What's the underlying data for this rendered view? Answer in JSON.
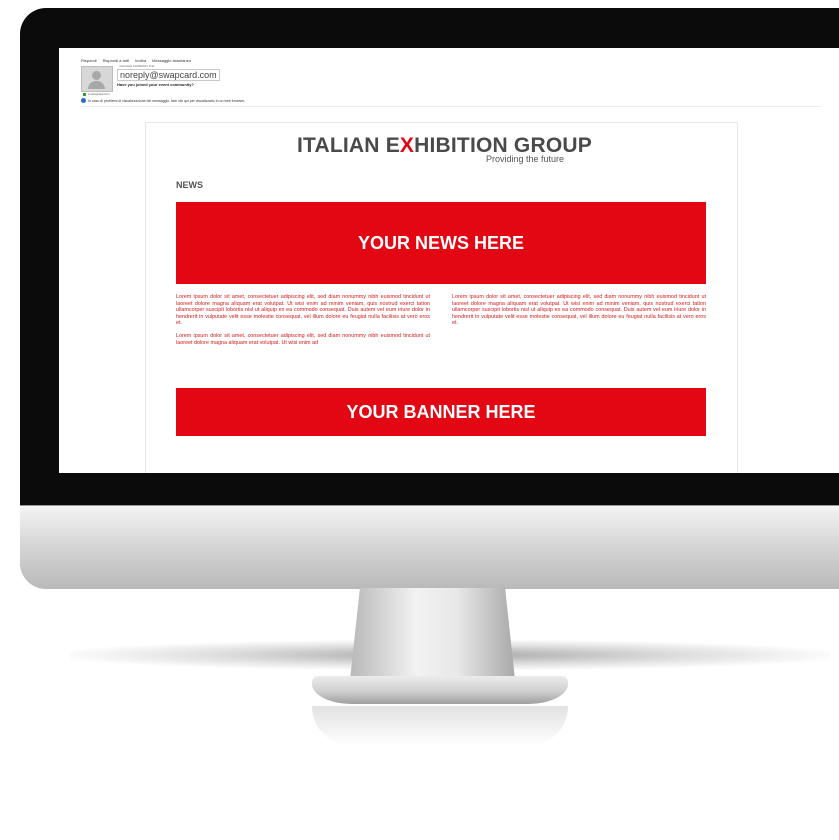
{
  "email": {
    "toolbar": [
      "Rispondi",
      "Rispondi a tutti",
      "Inoltra",
      "Messaggio istantaneo"
    ],
    "datetime": "mercoledì 10/05/2017 9:41",
    "sender": "noreply@swapcard.com",
    "subject": "Have you joined your event community?",
    "to": "a  swapcard.com",
    "info": "In caso di problemi di visualizzazione del messaggio, fare clic qui per visualizzarlo in un web browser."
  },
  "newsletter": {
    "logo_part1": "ITALIAN E",
    "logo_x": "X",
    "logo_part2": "HIBITION GROUP",
    "tagline": "Providing the future",
    "section_label": "NEWS",
    "news_banner": "YOUR NEWS HERE",
    "left_p1": "Lorem ipsum dolor sit amet, consectetuer adipiscing elit, sed diam nonummy nibh euismod tincidunt ut laoreet dolore magna aliquam erat volutpat. Ut wisi enim ad minim veniam, quis nostrud exerci tation ullamcorper suscipit lobortis nisl ut aliquip ex ea commodo consequat. Duis autem vel eum iriure dolor in hendrerit in vulputate velit esse molestie consequat, vel illum dolore eu feugiat nulla facilisis at vero eros et.",
    "left_p2": "Lorem ipsum dolor sit amet, consectetuer adipiscing elit, sed diam nonummy nibh euismod tincidunt ut laoreet dolore magna aliquam erat volutpat. Ut wisi enim ad",
    "right_p1": "Lorem ipsum dolor sit amet, consectetuer adipiscing elit, sed diam nonummy nibh euismod tincidunt ut laoreet dolore magna aliquam erat volutpat. Ut wisi enim ad minim veniam, quis nostrud exerci tation ullamcorper suscipit lobortis nisl ut aliquip ex ea commodo consequat. Duis autem vel eum iriure dolor in hendrerit in vulputate velit esse molestie consequat, vel illum dolore eu feugiat nulla facilisis at vero eros et.",
    "banner": "YOUR BANNER HERE"
  },
  "colors": {
    "brand_red": "#e30613",
    "bezel": "#0b0b0b"
  }
}
